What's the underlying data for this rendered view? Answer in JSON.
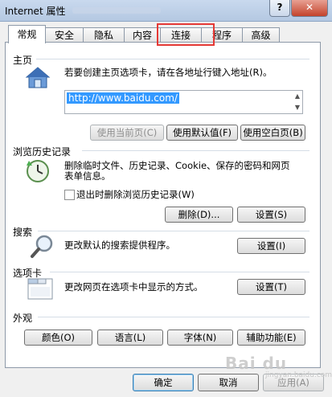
{
  "window": {
    "title": "Internet 属性",
    "help_label": "?",
    "close_label": "✕"
  },
  "tabs": [
    "常规",
    "安全",
    "隐私",
    "内容",
    "连接",
    "程序",
    "高级"
  ],
  "active_tab": "常规",
  "highlight_tab": "连接",
  "homepage": {
    "title": "主页",
    "description": "若要创建主页选项卡，请在各地址行键入地址(R)。",
    "url": "http://www.baidu.com/",
    "icon": "home-icon",
    "buttons": {
      "use_current": "使用当前页(C)",
      "use_default": "使用默认值(F)",
      "use_blank": "使用空白页(B)"
    }
  },
  "history": {
    "title": "浏览历史记录",
    "description_line1": "删除临时文件、历史记录、Cookie、保存的密码和网页",
    "description_line2": "表单信息。",
    "icon": "history-clock-icon",
    "checkbox_label": "退出时删除浏览历史记录(W)",
    "checkbox_checked": false,
    "buttons": {
      "delete": "删除(D)...",
      "settings": "设置(S)"
    }
  },
  "search": {
    "title": "搜索",
    "description": "更改默认的搜索提供程序。",
    "icon": "search-icon",
    "button": "设置(I)"
  },
  "tabs_section": {
    "title": "选项卡",
    "description": "更改网页在选项卡中显示的方式。",
    "icon": "tabs-window-icon",
    "button": "设置(T)"
  },
  "appearance": {
    "title": "外观",
    "buttons": {
      "colors": "颜色(O)",
      "languages": "语言(L)",
      "fonts": "字体(N)",
      "accessibility": "辅助功能(E)"
    }
  },
  "footer": {
    "ok": "确定",
    "cancel": "取消",
    "apply": "应用(A)"
  },
  "watermark": {
    "text": "Bai du",
    "subtext": "jingyan.baidu.com"
  }
}
